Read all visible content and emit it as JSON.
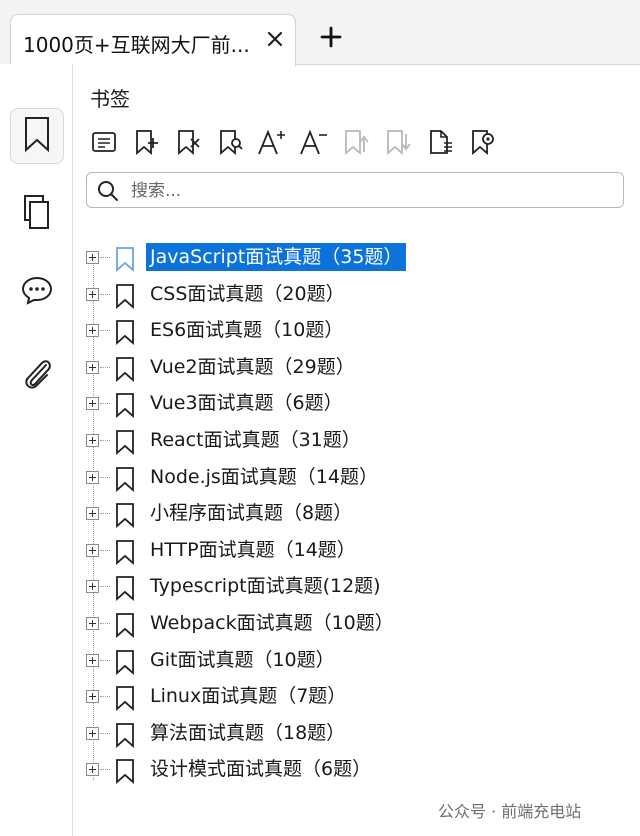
{
  "tab": {
    "title": "1000页+互联网大厂前...",
    "close_icon": "close-icon",
    "new_tab_icon": "plus-icon"
  },
  "rail": {
    "items": [
      {
        "name": "bookmarks",
        "icon": "bookmark-icon",
        "active": true
      },
      {
        "name": "pages",
        "icon": "pages-icon",
        "active": false
      },
      {
        "name": "comments",
        "icon": "comment-icon",
        "active": false
      },
      {
        "name": "attachments",
        "icon": "paperclip-icon",
        "active": false
      }
    ]
  },
  "panel": {
    "title": "书签",
    "toolbar": [
      {
        "name": "outline-view-icon",
        "enabled": true
      },
      {
        "name": "add-bookmark-icon",
        "enabled": true
      },
      {
        "name": "delete-bookmark-icon",
        "enabled": true
      },
      {
        "name": "find-bookmark-icon",
        "enabled": true
      },
      {
        "name": "increase-font-icon",
        "enabled": true
      },
      {
        "name": "decrease-font-icon",
        "enabled": true
      },
      {
        "name": "move-up-icon",
        "enabled": false
      },
      {
        "name": "move-down-icon",
        "enabled": false
      },
      {
        "name": "page-properties-icon",
        "enabled": true
      },
      {
        "name": "bookmark-settings-icon",
        "enabled": true
      }
    ],
    "search": {
      "placeholder": "搜索...",
      "value": ""
    }
  },
  "bookmarks": [
    {
      "label": "JavaScript面试真题（35题）",
      "selected": true
    },
    {
      "label": "CSS面试真题（20题）",
      "selected": false
    },
    {
      "label": "ES6面试真题（10题）",
      "selected": false
    },
    {
      "label": "Vue2面试真题（29题）",
      "selected": false
    },
    {
      "label": "Vue3面试真题（6题）",
      "selected": false
    },
    {
      "label": "React面试真题（31题）",
      "selected": false
    },
    {
      "label": "Node.js面试真题（14题）",
      "selected": false
    },
    {
      "label": "小程序面试真题（8题）",
      "selected": false
    },
    {
      "label": "HTTP面试真题（14题）",
      "selected": false
    },
    {
      "label": "Typescript面试真题(12题)",
      "selected": false
    },
    {
      "label": "Webpack面试真题（10题）",
      "selected": false
    },
    {
      "label": "Git面试真题（10题）",
      "selected": false
    },
    {
      "label": "Linux面试真题（7题）",
      "selected": false
    },
    {
      "label": "算法面试真题（18题）",
      "selected": false
    },
    {
      "label": "设计模式面试真题（6题）",
      "selected": false
    }
  ],
  "watermark": "公众号 · 前端充电站",
  "colors": {
    "selection": "#0b73d9",
    "icon": "#222222",
    "disabled_icon": "#b8b8b8"
  }
}
